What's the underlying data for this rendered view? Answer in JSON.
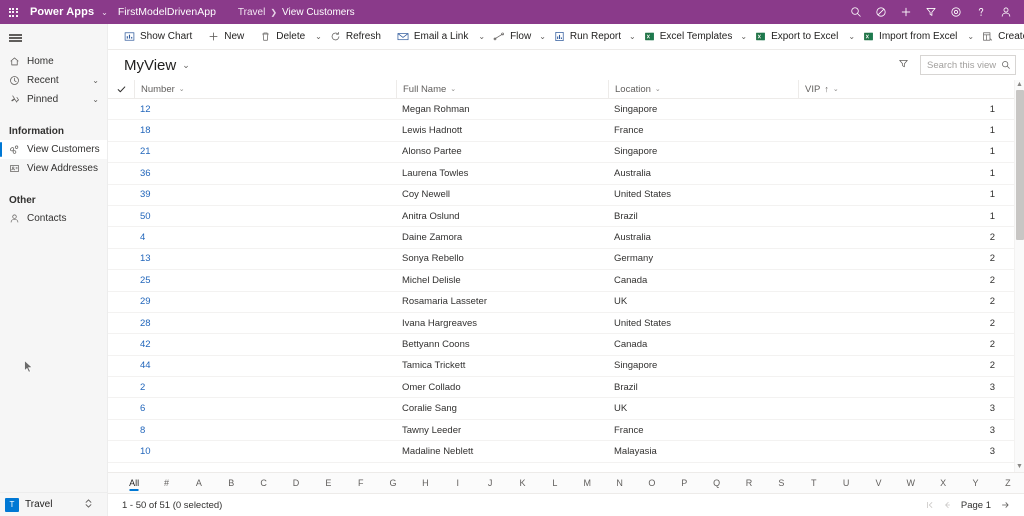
{
  "topbar": {
    "waffle_label": "app-launcher",
    "brand": "Power Apps",
    "brand_chevron": "⌄",
    "app_name": "FirstModelDrivenApp",
    "breadcrumb": [
      {
        "label": "Travel",
        "current": false
      },
      {
        "label": "View Customers",
        "current": true
      }
    ],
    "breadcrumb_separator": "❯",
    "icons": [
      "search-icon",
      "pending-icon",
      "add-icon",
      "filter-icon",
      "settings-icon",
      "help-icon",
      "account-icon"
    ],
    "background": "#8a3a8a"
  },
  "sidebar": {
    "hamburger": "site-map-toggle",
    "items": [
      {
        "label": "Home",
        "icon": "home-icon",
        "chevron": "",
        "selected": false
      },
      {
        "label": "Recent",
        "icon": "clock-icon",
        "chevron": "⌄",
        "selected": false
      },
      {
        "label": "Pinned",
        "icon": "pin-icon",
        "chevron": "⌄",
        "selected": false
      }
    ],
    "groups": [
      {
        "title": "Information",
        "items": [
          {
            "label": "View Customers",
            "icon": "customers-icon",
            "selected": true
          },
          {
            "label": "View Addresses",
            "icon": "addresses-icon",
            "selected": false
          }
        ]
      },
      {
        "title": "Other",
        "items": [
          {
            "label": "Contacts",
            "icon": "contact-icon",
            "selected": false
          }
        ]
      }
    ],
    "app_switcher": {
      "badge": "T",
      "name": "Travel",
      "chevron": "⌃⌄",
      "badge_color": "#0078d4"
    }
  },
  "commandbar": {
    "items": [
      {
        "label": "Show Chart",
        "icon": "chart-icon",
        "icon_color": "blue",
        "caret": false,
        "divider_after": false
      },
      {
        "label": "New",
        "icon": "plus-icon",
        "icon_color": "grey",
        "caret": false,
        "divider_after": false
      },
      {
        "label": "Delete",
        "icon": "trash-icon",
        "icon_color": "grey",
        "caret": true,
        "divider_after": true
      },
      {
        "label": "Refresh",
        "icon": "refresh-icon",
        "icon_color": "grey",
        "caret": false,
        "divider_after": false
      },
      {
        "label": "Email a Link",
        "icon": "email-link-icon",
        "icon_color": "blue",
        "caret": true,
        "divider_after": true
      },
      {
        "label": "Flow",
        "icon": "flow-icon",
        "icon_color": "grey",
        "caret": true,
        "divider_after": false
      },
      {
        "label": "Run Report",
        "icon": "report-icon",
        "icon_color": "blue",
        "caret": true,
        "divider_after": false
      },
      {
        "label": "Excel Templates",
        "icon": "excel-icon",
        "icon_color": "green",
        "caret": true,
        "divider_after": false
      },
      {
        "label": "Export to Excel",
        "icon": "excel-icon",
        "icon_color": "green",
        "caret": true,
        "divider_after": true
      },
      {
        "label": "Import from Excel",
        "icon": "excel-icon",
        "icon_color": "green",
        "caret": true,
        "divider_after": true
      },
      {
        "label": "Create view",
        "icon": "create-view-icon",
        "icon_color": "grey",
        "caret": false,
        "divider_after": false
      }
    ]
  },
  "view": {
    "title": "MyView",
    "title_chevron": "⌄",
    "filter_icon": "filter-icon",
    "search": {
      "placeholder": "Search this view",
      "value": "",
      "icon": "search-icon"
    }
  },
  "grid": {
    "select_all_icon": "checkmark-icon",
    "columns": [
      {
        "label": "Number",
        "chevron": "⌄",
        "sort": ""
      },
      {
        "label": "Full Name",
        "chevron": "⌄",
        "sort": ""
      },
      {
        "label": "Location",
        "chevron": "⌄",
        "sort": ""
      },
      {
        "label": "VIP",
        "chevron": "⌄",
        "sort": "↑"
      }
    ],
    "rows": [
      {
        "number": "12",
        "full_name": "Megan Rohman",
        "location": "Singapore",
        "vip": "1"
      },
      {
        "number": "18",
        "full_name": "Lewis Hadnott",
        "location": "France",
        "vip": "1"
      },
      {
        "number": "21",
        "full_name": "Alonso Partee",
        "location": "Singapore",
        "vip": "1"
      },
      {
        "number": "36",
        "full_name": "Laurena Towles",
        "location": "Australia",
        "vip": "1"
      },
      {
        "number": "39",
        "full_name": "Coy Newell",
        "location": "United States",
        "vip": "1"
      },
      {
        "number": "50",
        "full_name": "Anitra Oslund",
        "location": "Brazil",
        "vip": "1"
      },
      {
        "number": "4",
        "full_name": "Daine Zamora",
        "location": "Australia",
        "vip": "2"
      },
      {
        "number": "13",
        "full_name": "Sonya Rebello",
        "location": "Germany",
        "vip": "2"
      },
      {
        "number": "25",
        "full_name": "Michel Delisle",
        "location": "Canada",
        "vip": "2"
      },
      {
        "number": "29",
        "full_name": "Rosamaria Lasseter",
        "location": "UK",
        "vip": "2"
      },
      {
        "number": "28",
        "full_name": "Ivana Hargreaves",
        "location": "United States",
        "vip": "2"
      },
      {
        "number": "42",
        "full_name": "Bettyann Coons",
        "location": "Canada",
        "vip": "2"
      },
      {
        "number": "44",
        "full_name": "Tamica Trickett",
        "location": "Singapore",
        "vip": "2"
      },
      {
        "number": "2",
        "full_name": "Omer Collado",
        "location": "Brazil",
        "vip": "3"
      },
      {
        "number": "6",
        "full_name": "Coralie Sang",
        "location": "UK",
        "vip": "3"
      },
      {
        "number": "8",
        "full_name": "Tawny Leeder",
        "location": "France",
        "vip": "3"
      },
      {
        "number": "10",
        "full_name": "Madaline Neblett",
        "location": "Malayasia",
        "vip": "3"
      }
    ]
  },
  "alphabet": {
    "items": [
      "All",
      "#",
      "A",
      "B",
      "C",
      "D",
      "E",
      "F",
      "G",
      "H",
      "I",
      "J",
      "K",
      "L",
      "M",
      "N",
      "O",
      "P",
      "Q",
      "R",
      "S",
      "T",
      "U",
      "V",
      "W",
      "X",
      "Y",
      "Z"
    ],
    "active": "All"
  },
  "status": {
    "record_count": "1 - 50 of 51 (0 selected)",
    "pager": {
      "first_icon": "first-page-icon",
      "prev_icon": "prev-page-icon",
      "page_label": "Page 1",
      "next_icon": "next-page-icon"
    }
  }
}
